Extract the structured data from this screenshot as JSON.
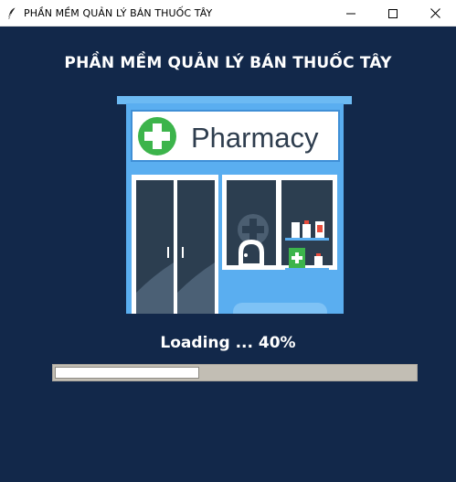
{
  "window": {
    "title": "PHẦN MỀM QUẢN LÝ BÁN THUỐC TÂY",
    "icon": "feather-icon",
    "controls": [
      "minimize-icon",
      "maximize-icon",
      "close-icon"
    ]
  },
  "heading": "PHẦN MỀM QUẢN LÝ BÁN THUỐC TÂY",
  "illustration": {
    "sign_text": "Pharmacy",
    "colors": {
      "building": "#5aaef0",
      "roof": "#6cbaf3",
      "sign": "#ffffff",
      "sign_text": "#2e3d4e",
      "cross_green": "#3cb44b",
      "glass": "#2c3e50"
    }
  },
  "loading": {
    "text": "Loading ... 40%",
    "progress": 0.4
  },
  "colors": {
    "background": "#12284a",
    "progress_track": "#c2beb4",
    "progress_fill": "#ffffff"
  }
}
